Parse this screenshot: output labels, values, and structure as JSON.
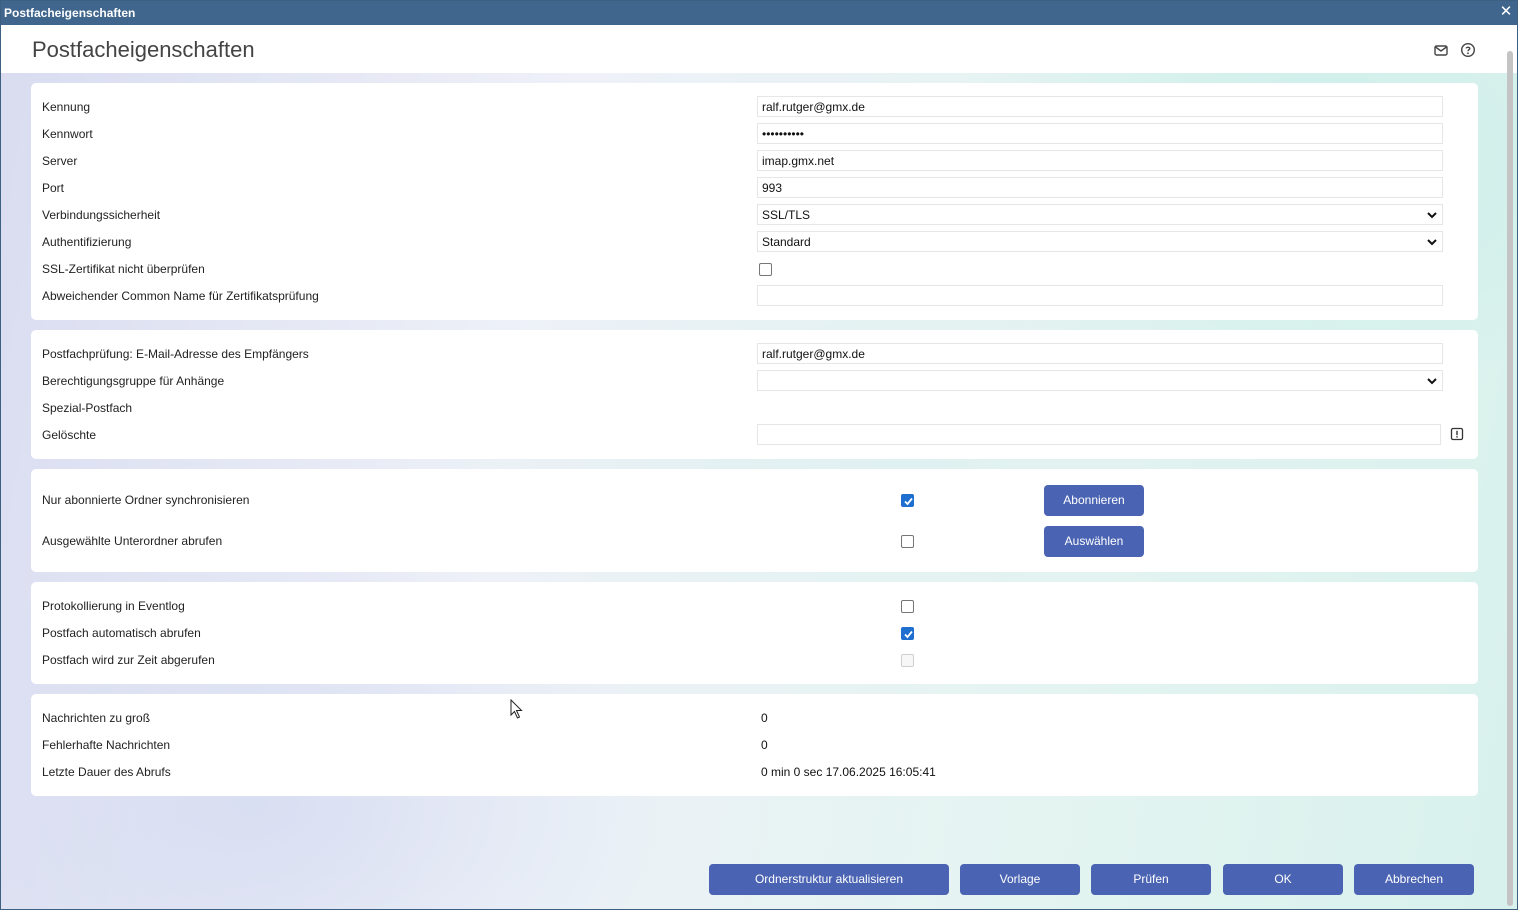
{
  "window": {
    "title": "Postfacheigenschaften"
  },
  "header": {
    "title": "Postfacheigenschaften",
    "icons": [
      "mail-icon",
      "help-icon"
    ]
  },
  "connection": {
    "kennung_label": "Kennung",
    "kennung_value": "ralf.rutger@gmx.de",
    "kennwort_label": "Kennwort",
    "kennwort_value": "••••••••••",
    "server_label": "Server",
    "server_value": "imap.gmx.net",
    "port_label": "Port",
    "port_value": "993",
    "security_label": "Verbindungssicherheit",
    "security_value": "SSL/TLS",
    "auth_label": "Authentifizierung",
    "auth_value": "Standard",
    "ssl_check_label": "SSL-Zertifikat nicht überprüfen",
    "ssl_check_checked": false,
    "common_name_label": "Abweichender Common Name für Zertifikatsprüfung",
    "common_name_value": ""
  },
  "mailbox": {
    "recipient_label": "Postfachprüfung: E-Mail-Adresse des Empfängers",
    "recipient_value": "ralf.rutger@gmx.de",
    "permission_label": "Berechtigungsgruppe für Anhänge",
    "permission_value": "",
    "special_label": "Spezial-Postfach",
    "deleted_label": "Gelöschte",
    "deleted_value": ""
  },
  "sync": {
    "subscribed_label": "Nur abonnierte Ordner synchronisieren",
    "subscribed_checked": true,
    "subscribe_button": "Abonnieren",
    "subfolders_label": "Ausgewählte Unterordner abrufen",
    "subfolders_checked": false,
    "select_button": "Auswählen"
  },
  "options": {
    "eventlog_label": "Protokollierung in Eventlog",
    "eventlog_checked": false,
    "auto_fetch_label": "Postfach automatisch abrufen",
    "auto_fetch_checked": true,
    "fetching_now_label": "Postfach wird zur Zeit abgerufen",
    "fetching_now_checked": false
  },
  "stats": {
    "too_large_label": "Nachrichten zu groß",
    "too_large_value": "0",
    "faulty_label": "Fehlerhafte Nachrichten",
    "faulty_value": "0",
    "last_duration_label": "Letzte Dauer des Abrufs",
    "last_duration_value": "0 min 0 sec 17.06.2025 16:05:41"
  },
  "footer": {
    "refresh_button": "Ordnerstruktur aktualisieren",
    "template_button": "Vorlage",
    "check_button": "Prüfen",
    "ok_button": "OK",
    "cancel_button": "Abbrechen"
  },
  "colors": {
    "titlebar": "#40668d",
    "button": "#4a64b3",
    "checkbox_checked": "#1e6fd0"
  }
}
